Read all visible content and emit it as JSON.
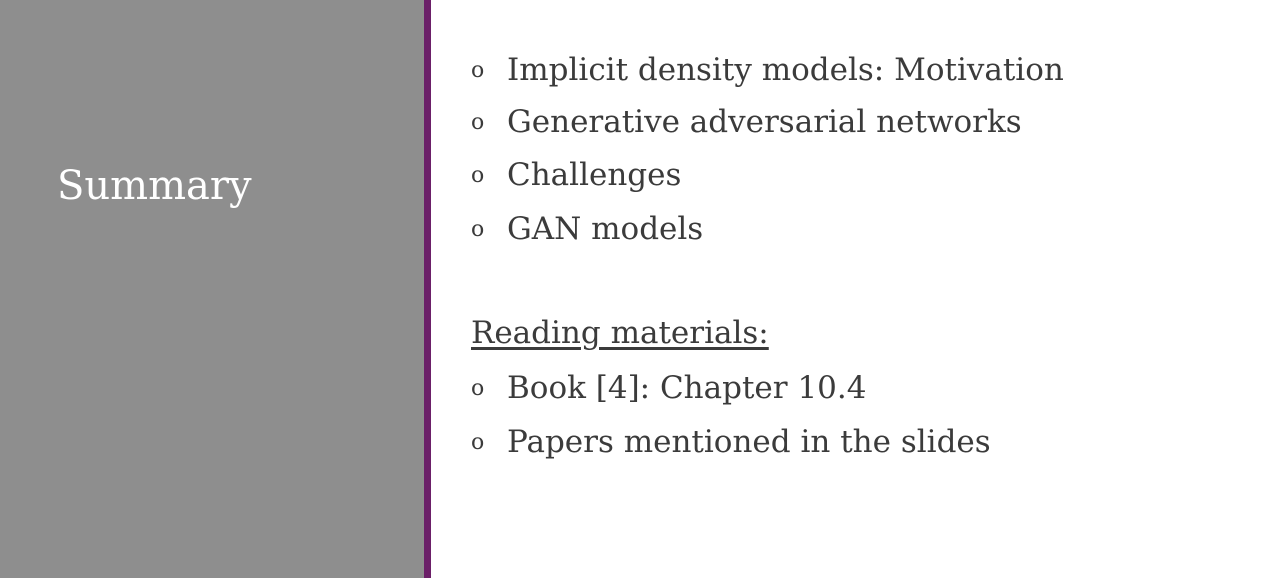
{
  "slide": {
    "title": "Summary",
    "topics": [
      "Implicit density models: Motivation",
      "Generative adversarial networks",
      "Challenges",
      "GAN models"
    ],
    "reading_heading": "Reading materials:",
    "readings": [
      "Book [4]: Chapter 10.4",
      "Papers mentioned in the slides"
    ],
    "bullet_symbol": "o"
  },
  "colors": {
    "left_panel": "#8e8e8e",
    "divider": "#6b1f68",
    "text": "#3b3b3b"
  }
}
